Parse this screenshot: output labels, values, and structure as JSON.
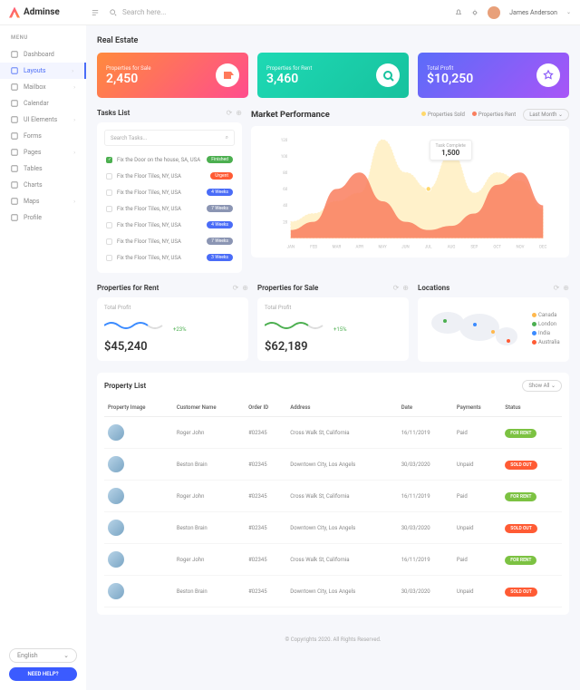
{
  "brand": "Adminse",
  "search_ph": "Search here...",
  "user": "James Anderson",
  "menu_label": "MENU",
  "nav": [
    {
      "label": "Dashboard",
      "icon": "grid"
    },
    {
      "label": "Layouts",
      "icon": "layers",
      "active": true,
      "exp": true
    },
    {
      "label": "Mailbox",
      "icon": "mail",
      "exp": true
    },
    {
      "label": "Calendar",
      "icon": "cal"
    },
    {
      "label": "UI Elements",
      "icon": "bolt",
      "exp": true
    },
    {
      "label": "Forms",
      "icon": "form"
    },
    {
      "label": "Pages",
      "icon": "page",
      "exp": true
    },
    {
      "label": "Tables",
      "icon": "tbl"
    },
    {
      "label": "Charts",
      "icon": "chart"
    },
    {
      "label": "Maps",
      "icon": "map",
      "exp": true
    },
    {
      "label": "Profile",
      "icon": "user"
    }
  ],
  "lang": "English",
  "help": "NEED HELP?",
  "page_title": "Real Estate",
  "cards": [
    {
      "title": "Properties for Sale",
      "value": "2,450"
    },
    {
      "title": "Properties for Rent",
      "value": "3,460"
    },
    {
      "title": "Total Profit",
      "value": "$10,250"
    }
  ],
  "tasks": {
    "title": "Tasks List",
    "search": "Search Tasks...",
    "items": [
      {
        "txt": "Fix the Door on the house, SA, USA",
        "badge": "Finished",
        "cls": "b-fin",
        "done": true
      },
      {
        "txt": "Fix the Floor Tiles, NY, USA",
        "badge": "Urgent",
        "cls": "b-urg"
      },
      {
        "txt": "Fix the Floor Tiles, NY, USA",
        "badge": "4 Weeks",
        "cls": "b-4w"
      },
      {
        "txt": "Fix the Floor Tiles, NY, USA",
        "badge": "7 Weeks",
        "cls": "b-7w"
      },
      {
        "txt": "Fix the Floor Tiles, NY, USA",
        "badge": "4 Weeks",
        "cls": "b-4w"
      },
      {
        "txt": "Fix the Floor Tiles, NY, USA",
        "badge": "7 Weeks",
        "cls": "b-7w"
      },
      {
        "txt": "Fix the Floor Tiles, NY, USA",
        "badge": "3 Weeks",
        "cls": "b-3w"
      }
    ]
  },
  "perf": {
    "title": "Market Performance",
    "legend": [
      "Properties Sold",
      "Properties Rent"
    ],
    "range": "Last Month",
    "tip_label": "Task Complete",
    "tip_value": "1,500"
  },
  "mini_cards": [
    {
      "title": "Properties for Rent",
      "sub": "Total Profit",
      "value": "$45,240",
      "pct": "+23%",
      "color": "#3b8bff"
    },
    {
      "title": "Properties for Sale",
      "sub": "Total Profit",
      "value": "$62,189",
      "pct": "+15%",
      "color": "#4caf50"
    }
  ],
  "locations": {
    "title": "Locations",
    "items": [
      {
        "name": "Canada",
        "color": "#ffb84d"
      },
      {
        "name": "London",
        "color": "#4caf50"
      },
      {
        "name": "India",
        "color": "#3b8bff"
      },
      {
        "name": "Australia",
        "color": "#ff5b34"
      }
    ]
  },
  "plist": {
    "title": "Property List",
    "filter": "Show All",
    "cols": [
      "Property Image",
      "Customer Name",
      "Order ID",
      "Address",
      "Date",
      "Payments",
      "Status"
    ],
    "rows": [
      {
        "name": "Roger John",
        "oid": "#02345",
        "addr": "Cross Walk St, California",
        "date": "16/11/2019",
        "pay": "Paid",
        "st": "FOR RENT",
        "sc": "st-r"
      },
      {
        "name": "Beston Brain",
        "oid": "#02345",
        "addr": "Downtown City, Los Angels",
        "date": "30/03/2020",
        "pay": "Unpaid",
        "st": "SOLD OUT",
        "sc": "st-s"
      },
      {
        "name": "Roger John",
        "oid": "#02345",
        "addr": "Cross Walk St, California",
        "date": "16/11/2019",
        "pay": "Paid",
        "st": "FOR RENT",
        "sc": "st-r"
      },
      {
        "name": "Beston Brain",
        "oid": "#02345",
        "addr": "Downtown City, Los Angels",
        "date": "30/03/2020",
        "pay": "Unpaid",
        "st": "SOLD OUT",
        "sc": "st-s"
      },
      {
        "name": "Roger John",
        "oid": "#02345",
        "addr": "Cross Walk St, California",
        "date": "16/11/2019",
        "pay": "Paid",
        "st": "FOR RENT",
        "sc": "st-r"
      },
      {
        "name": "Beston Brain",
        "oid": "#02345",
        "addr": "Downtown City, Los Angels",
        "date": "30/03/2020",
        "pay": "Unpaid",
        "st": "SOLD OUT",
        "sc": "st-s"
      }
    ]
  },
  "footer": "© Copyrights 2020. All Rights Reserved.",
  "chart_data": {
    "type": "area",
    "x": [
      "JAN",
      "FEB",
      "MAR",
      "APR",
      "MAY",
      "JUN",
      "JUL",
      "AUG",
      "SEP",
      "OCT",
      "NOV",
      "DEC"
    ],
    "series": [
      {
        "name": "Properties Sold",
        "color": "#ffd86b",
        "values": [
          20,
          30,
          45,
          55,
          120,
          80,
          60,
          105,
          55,
          80,
          70,
          35
        ]
      },
      {
        "name": "Properties Rent",
        "color": "#f97e5e",
        "values": [
          10,
          20,
          60,
          80,
          45,
          20,
          10,
          15,
          30,
          65,
          80,
          40
        ]
      }
    ],
    "ylim": [
      0,
      120
    ],
    "yticks": [
      20,
      40,
      60,
      80,
      100,
      120
    ]
  }
}
